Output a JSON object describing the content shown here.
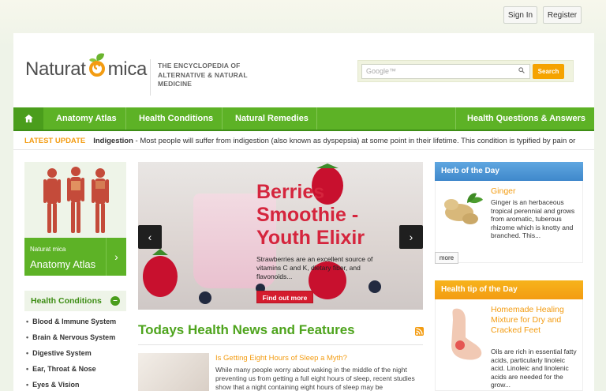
{
  "header": {
    "sign_in": "Sign In",
    "register": "Register"
  },
  "logo": {
    "part1": "Naturat",
    "part2": "mica",
    "tagline": "THE ENCYCLOPEDIA OF ALTERNATIVE & NATURAL MEDICINE"
  },
  "search": {
    "placeholder": "Google™",
    "button": "Search"
  },
  "nav": {
    "items": [
      "Anatomy Atlas",
      "Health Conditions",
      "Natural Remedies",
      "Health Questions & Answers"
    ]
  },
  "update": {
    "label": "LATEST UPDATE",
    "title": "Indigestion",
    "text": " - Most people will suffer from indigestion (also known as dyspepsia) at some point in their lifetime. This condition is typified by pain or"
  },
  "atlas": {
    "mini_logo": "Naturat mica",
    "title": "Anatomy Atlas",
    "arrow": "›"
  },
  "health_conditions": {
    "title": "Health Conditions",
    "toggle": "–",
    "items": [
      "Blood & Immune System",
      "Brain & Nervous System",
      "Digestive System",
      "Ear, Throat & Nose",
      "Eyes & Vision"
    ]
  },
  "slider": {
    "headline": "Berries Smoothie - Youth Elixir",
    "desc": "Strawberries are an excellent source of vitamins C and K, dietary fiber, and flavonoids...",
    "button": "Find out more",
    "prev": "‹",
    "next": "›"
  },
  "news": {
    "heading": "Todays Health News and Features",
    "item_title": "Is Getting Eight Hours of Sleep a Myth?",
    "item_text": "While many people worry about waking in the middle of the night preventing us from getting a full eight hours of sleep, recent studies show that a night containing eight hours of sleep may be"
  },
  "herb": {
    "heading": "Herb of the Day",
    "title": "Ginger",
    "text": "Ginger is an herbaceous tropical perennial and grows from aromatic, tuberous rhizome which is knotty and branched. This...",
    "more": "more"
  },
  "tip": {
    "heading": "Health tip of the Day",
    "title": "Homemade Healing Mixture for Dry and Cracked Feet",
    "text": "Oils are rich in essential fatty acids, particularly linoleic acid. Linoleic and linolenic acids are needed for the grow..."
  },
  "colors": {
    "green": "#5db226",
    "orange": "#f39c12",
    "blue": "#4a93d2",
    "red": "#d41c2e"
  }
}
